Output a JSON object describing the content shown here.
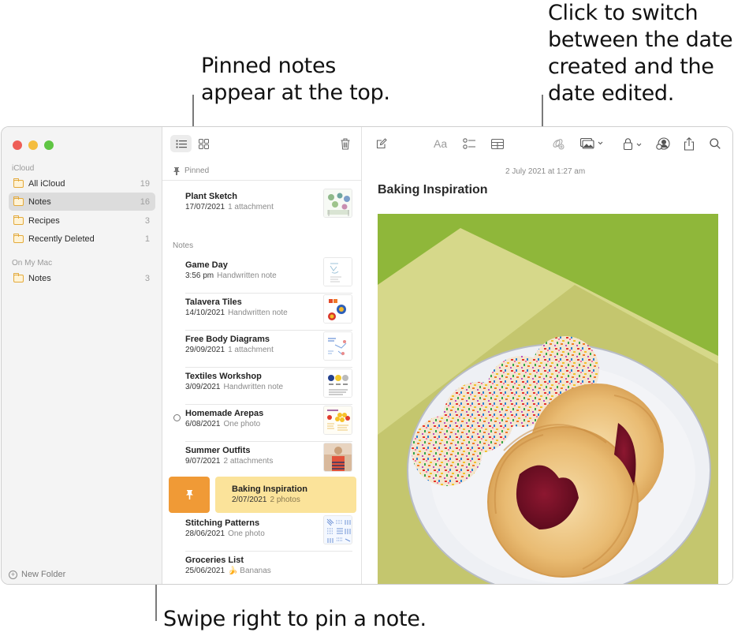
{
  "callouts": {
    "pinned_top": [
      "Pinned notes",
      "appear at the top."
    ],
    "date_switch": [
      "Click to switch",
      "between the date",
      "created and the",
      "date edited."
    ],
    "swipe_pin": "Swipe right to pin a note."
  },
  "window_controls": {
    "close_color": "#ee5e57",
    "minimize_color": "#f4bd3d",
    "zoom_color": "#5fc543"
  },
  "sidebar": {
    "sections": [
      {
        "label": "iCloud",
        "folders": [
          {
            "name": "All iCloud",
            "count": "19",
            "selected": false
          },
          {
            "name": "Notes",
            "count": "16",
            "selected": true
          },
          {
            "name": "Recipes",
            "count": "3",
            "selected": false
          },
          {
            "name": "Recently Deleted",
            "count": "1",
            "selected": false
          }
        ]
      },
      {
        "label": "On My Mac",
        "folders": [
          {
            "name": "Notes",
            "count": "3",
            "selected": false
          }
        ]
      }
    ],
    "new_folder_label": "New Folder"
  },
  "note_list": {
    "pinned_label": "Pinned",
    "notes_label": "Notes",
    "pinned": [
      {
        "title": "Plant Sketch",
        "date": "17/07/2021",
        "detail": "1 attachment"
      }
    ],
    "notes": [
      {
        "title": "Game Day",
        "date": "3:56 pm",
        "detail": "Handwritten note"
      },
      {
        "title": "Talavera Tiles",
        "date": "14/10/2021",
        "detail": "Handwritten note"
      },
      {
        "title": "Free Body Diagrams",
        "date": "29/09/2021",
        "detail": "1 attachment"
      },
      {
        "title": "Textiles Workshop",
        "date": "3/09/2021",
        "detail": "Handwritten note"
      },
      {
        "title": "Homemade Arepas",
        "date": "6/08/2021",
        "detail": "One photo",
        "shared": true
      },
      {
        "title": "Summer Outfits",
        "date": "9/07/2021",
        "detail": "2 attachments"
      },
      {
        "title": "Baking Inspiration",
        "date": "2/07/2021",
        "detail": "2 photos",
        "swiped": true
      },
      {
        "title": "Stitching Patterns",
        "date": "28/06/2021",
        "detail": "One photo"
      },
      {
        "title": "Groceries List",
        "date": "25/06/2021",
        "detail": "🍌 Bananas"
      }
    ],
    "pin_action_color": "#f09a36",
    "swiped_color": "#fbe39a"
  },
  "editor": {
    "date": "2 July 2021  at 1:27 am",
    "title": "Baking Inspiration",
    "toolbar_icons": [
      "compose-icon",
      "format-icon",
      "checklist-icon",
      "table-icon",
      "link-icon",
      "media-icon",
      "lock-icon",
      "collaborate-icon",
      "share-icon",
      "search-icon"
    ],
    "format_label": "Aa"
  }
}
